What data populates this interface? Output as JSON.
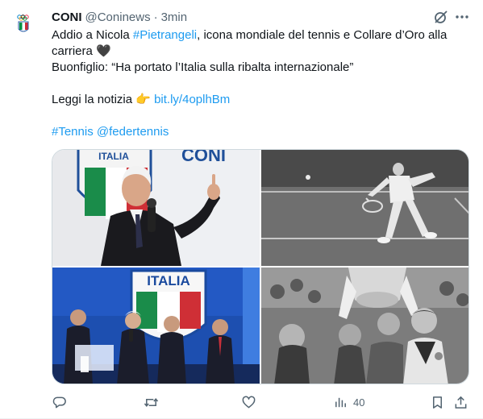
{
  "tweet": {
    "author_name": "CONI",
    "handle": "@Coninews",
    "separator": "·",
    "time": "3min",
    "avatar_label": "CONI",
    "lines": {
      "l1_a": "Addio a Nicola ",
      "l1_hashtag": "#Pietrangeli",
      "l1_b": ", icona mondiale del tennis e Collare d’Oro alla",
      "l2": "carriera 🖤",
      "l3": "Buonfiglio: “Ha portato l’Italia sulla ribalta internazionale”",
      "l5_a": "Leggi la notizia 👉 ",
      "l5_link": "bit.ly/4oplhBm",
      "l7_hashtag": "#Tennis",
      "l7_mention": "@federtennis"
    },
    "media": {
      "photo1_sign": "CONI",
      "photo1_badge": "ITALIA",
      "photo3_banner": "ITALIA"
    },
    "actions": {
      "views_count": "40"
    }
  }
}
